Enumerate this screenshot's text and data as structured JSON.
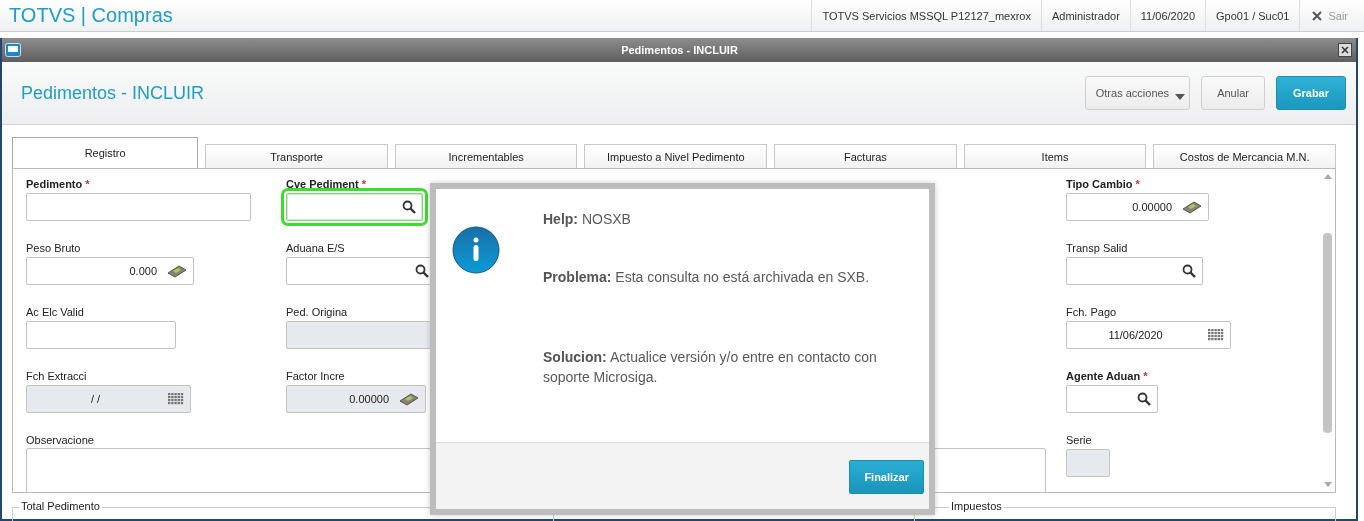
{
  "app_bar": {
    "brand": "TOTVS | Compras",
    "items": [
      "TOTVS Servicios MSSQL P12127_mexrox",
      "Administrador",
      "11/06/2020",
      "Gpo01 / Suc01"
    ],
    "exit": "Sair"
  },
  "window": {
    "title": "Pedimentos - INCLUIR"
  },
  "header": {
    "title": "Pedimentos - INCLUIR",
    "buttons": [
      {
        "label": "Otras acciones",
        "kind": "menu"
      },
      {
        "label": "Anular",
        "kind": "plain"
      },
      {
        "label": "Grabar",
        "kind": "primary"
      }
    ]
  },
  "tabs": [
    {
      "label": "Registro",
      "selected": true
    },
    {
      "label": "Transporte",
      "selected": false
    },
    {
      "label": "Incrementables",
      "selected": false
    },
    {
      "label": "Impuesto a Nivel Pedimento",
      "selected": false
    },
    {
      "label": "Facturas",
      "selected": false
    },
    {
      "label": "Items",
      "selected": false
    },
    {
      "label": "Costos de Mercancia M.N.",
      "selected": false
    }
  ],
  "form_columns": [
    [
      {
        "label": "Pedimento",
        "required_mark": "*",
        "kind": "text",
        "disabled": false,
        "focused": false
      },
      {
        "label": "Peso Bruto",
        "kind": "number",
        "value": "0.000",
        "disabled": false,
        "focused": false
      },
      {
        "label": "Ac Elc Valid",
        "kind": "text",
        "disabled": false,
        "focused": false
      },
      {
        "label": "Fch Extracci",
        "kind": "date",
        "value": "/ /",
        "disabled": true,
        "focused": false
      },
      {
        "label": "Observacione",
        "kind": "memo",
        "disabled": false,
        "focused": false
      }
    ],
    [
      {
        "label": "Cve Pediment",
        "required_mark": "*",
        "kind": "lookup",
        "disabled": false,
        "focused": true
      },
      {
        "label": "Aduana E/S",
        "kind": "lookup",
        "disabled": false,
        "focused": false
      },
      {
        "label": "Ped. Origina",
        "kind": "text",
        "disabled": true,
        "focused": false
      },
      {
        "label": "Factor Incre",
        "kind": "number",
        "value": "0.00000",
        "disabled": true,
        "focused": false
      }
    ],
    [
      {
        "label": "Tipo Cambio",
        "required_mark": "*",
        "kind": "number",
        "value": "0.00000",
        "disabled": false,
        "focused": false
      },
      {
        "label": "Transp Salid",
        "kind": "lookup",
        "disabled": false,
        "focused": false
      },
      {
        "label": "Fch. Pago",
        "kind": "date",
        "value": "11/06/2020",
        "disabled": false,
        "focused": false
      },
      {
        "label": "Agente Aduan",
        "required_mark": "*",
        "kind": "lookup",
        "disabled": false,
        "focused": false
      },
      {
        "label": "Serie",
        "kind": "text",
        "disabled": true,
        "focused": false
      }
    ]
  ],
  "sections": [
    "Total Pedimento",
    "Impuestos"
  ],
  "dialog": {
    "help_label": "Help:",
    "help": "NOSXB",
    "problem_label": "Problema:",
    "problem": "Esta consulta no está archivada en SXB.",
    "solution_label": "Solucion:",
    "solution": "Actualice versión y/o entre en contacto con soporte Microsiga.",
    "button": "Finalizar"
  }
}
